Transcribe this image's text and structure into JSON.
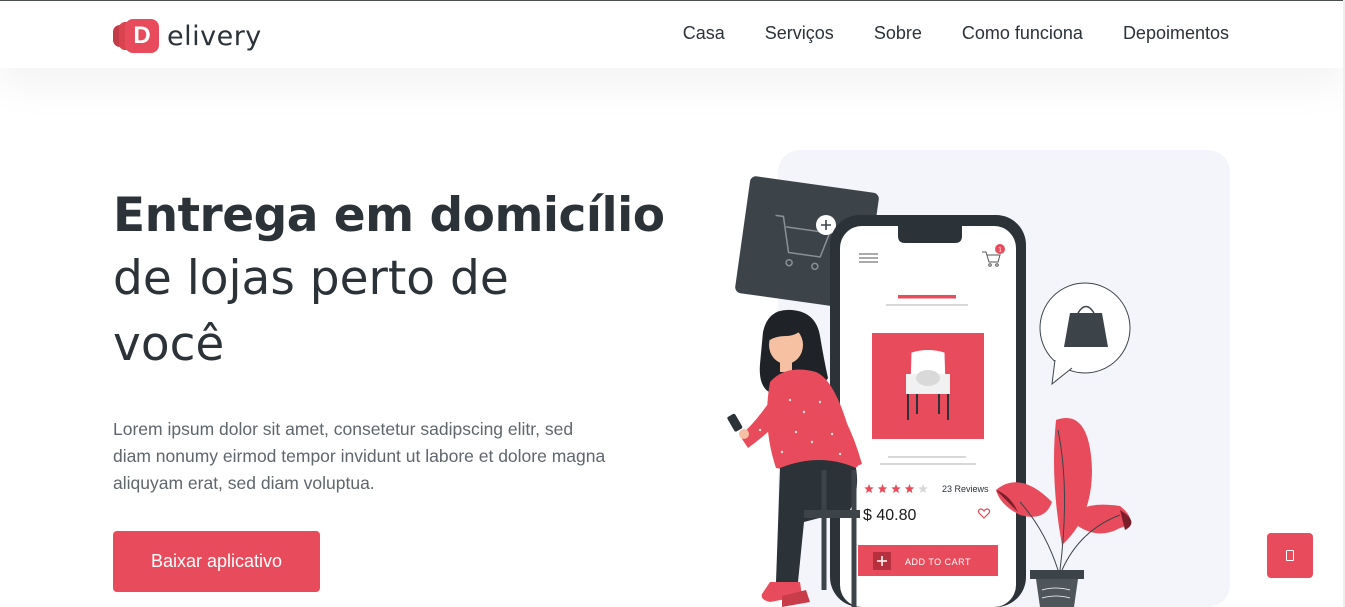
{
  "brand": {
    "logo_letter": "D",
    "name_rest": "elivery"
  },
  "nav": {
    "items": [
      {
        "label": "Casa"
      },
      {
        "label": "Serviços"
      },
      {
        "label": "Sobre"
      },
      {
        "label": "Como funciona"
      },
      {
        "label": "Depoimentos"
      }
    ]
  },
  "hero": {
    "title_bold": "Entrega em domicílio",
    "title_line2": "de lojas perto de",
    "title_line3": "você",
    "description": "Lorem ipsum dolor sit amet, consetetur sadipscing elitr, sed diam nonumy eirmod tempor invidunt ut labore et dolore magna aliquyam erat, sed diam voluptua.",
    "cta_label": "Baixar aplicativo"
  },
  "illustration": {
    "cart_badge": "1",
    "reviews": "23 Reviews",
    "rating_stars": 4,
    "rating_max": 5,
    "price": "$ 40.80",
    "add_to_cart": "ADD TO CART"
  },
  "colors": {
    "accent": "#e84b5b",
    "dark": "#2b3238",
    "text_muted": "#5f666c",
    "illustration_bg": "#f4f5fb"
  },
  "icons": {
    "float_button": "mobile-icon",
    "phone_menu": "hamburger-menu-icon",
    "phone_cart": "shopping-cart-icon",
    "product": "armchair-icon",
    "favorite": "heart-icon"
  }
}
